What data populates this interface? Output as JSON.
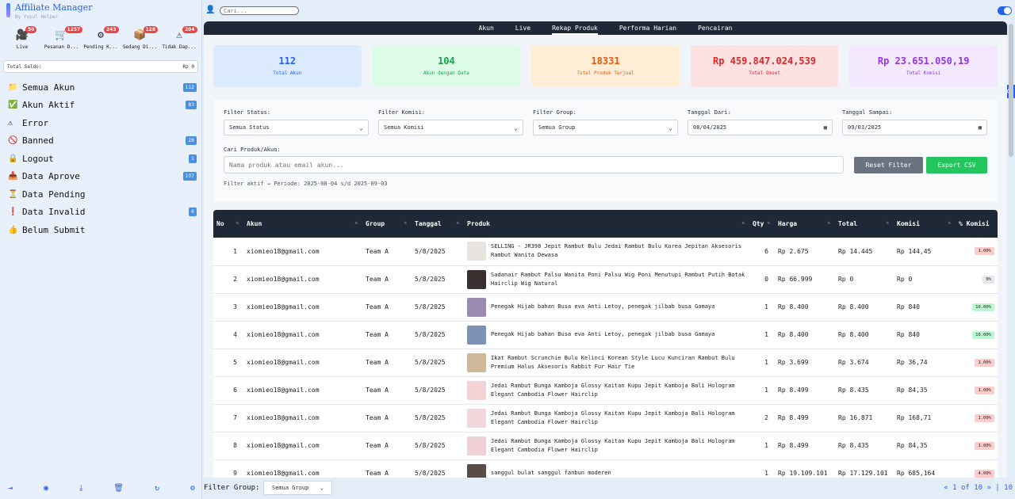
{
  "app": {
    "title": "Affiliate Manager",
    "subtitle": "By Yuyul Helper"
  },
  "stats": [
    {
      "icon": "camera-icon",
      "glyph": "🎥",
      "badge": "50",
      "label": "Live"
    },
    {
      "icon": "cart-icon",
      "glyph": "🛒",
      "badge": "1257",
      "label": "Pesanan D..."
    },
    {
      "icon": "gear-icon",
      "glyph": "⚙",
      "badge": "243",
      "label": "Pending K..."
    },
    {
      "icon": "package-icon",
      "glyph": "📦",
      "badge": "128",
      "label": "Sedang Di..."
    },
    {
      "icon": "warning-icon",
      "glyph": "⚠",
      "badge": "204",
      "label": "Tidak Dap..."
    }
  ],
  "saldo": {
    "label": "Total Saldo:",
    "value": "Rp 0"
  },
  "menu": [
    {
      "icon": "folder-icon",
      "glyph": "📁",
      "label": "Semua Akun",
      "count": "112"
    },
    {
      "icon": "check-icon",
      "glyph": "✅",
      "label": "Akun Aktif",
      "count": "83"
    },
    {
      "icon": "warning-icon",
      "glyph": "⚠",
      "label": "Error",
      "count": ""
    },
    {
      "icon": "ban-icon",
      "glyph": "🚫",
      "label": "Banned",
      "count": "28"
    },
    {
      "icon": "lock-icon",
      "glyph": "🔒",
      "label": "Logout",
      "count": "1"
    },
    {
      "icon": "inbox-icon",
      "glyph": "📥",
      "label": "Data Aprove",
      "count": "107"
    },
    {
      "icon": "hourglass-icon",
      "glyph": "⏳",
      "label": "Data Pending",
      "count": ""
    },
    {
      "icon": "exclamation-icon",
      "glyph": "❗",
      "label": "Data Invalid",
      "count": "6"
    },
    {
      "icon": "thumbs-up-icon",
      "glyph": "👍",
      "label": "Belum Submit",
      "count": ""
    }
  ],
  "search": {
    "placeholder": "Cari..."
  },
  "tabs": [
    "Akun",
    "Live",
    "Rekap Produk",
    "Performa Harian",
    "Pencairan"
  ],
  "active_tab": "Rekap Produk",
  "cards": [
    {
      "value": "112",
      "label": "Total Akun",
      "color": "#2563eb",
      "bg": "#dbeafe"
    },
    {
      "value": "104",
      "label": "Akun dengan Data",
      "color": "#16a34a",
      "bg": "#dcfce7"
    },
    {
      "value": "18331",
      "label": "Total Produk Terjual",
      "color": "#ea580c",
      "bg": "#ffedd5"
    },
    {
      "value": "Rp 459.847.024,539",
      "label": "Total Omset",
      "color": "#dc2626",
      "bg": "#fee2e2"
    },
    {
      "value": "Rp 23.651.050,19",
      "label": "Total Komisi",
      "color": "#9333ea",
      "bg": "#f3e8ff"
    }
  ],
  "filters": {
    "status": {
      "label": "Filter Status:",
      "value": "Semua Status"
    },
    "komisi": {
      "label": "Filter Komisi:",
      "value": "Semua Komisi"
    },
    "group": {
      "label": "Filter Group:",
      "value": "Semua Group"
    },
    "date_from": {
      "label": "Tanggal Dari:",
      "value": "08/04/2025"
    },
    "date_to": {
      "label": "Tanggal Sampai:",
      "value": "09/03/2025"
    },
    "search_label": "Cari Produk/Akun:",
    "search_placeholder": "Nama produk atau email akun...",
    "reset_label": "Reset Filter",
    "export_label": "Export CSV",
    "active_text": "Filter aktif → Periode: 2025-08-04 s/d 2025-09-03"
  },
  "table": {
    "headers": [
      "No",
      "Akun",
      "Group",
      "Tanggal",
      "Produk",
      "Qty",
      "Harga",
      "Total",
      "Komisi",
      "% Komisi"
    ],
    "rows": [
      {
        "no": "1",
        "akun": "xiomieo18@gmail.com",
        "group": "Team A",
        "tanggal": "5/8/2025",
        "produk": "SELLING - JR398 Jepit Rambut Bulu Jedai Rambut Bulu Korea Jepitan Aksesoris Rambut Wanita Dewasa",
        "thumb": "#e8e4e0",
        "qty": "6",
        "harga": "Rp 2.675",
        "total": "Rp 14.445",
        "komisi": "Rp 144,45",
        "pct": "1.00%",
        "pct_color": "#fecaca"
      },
      {
        "no": "2",
        "akun": "xiomieo18@gmail.com",
        "group": "Team A",
        "tanggal": "5/8/2025",
        "produk": "Sadanair Rambut Palsu Wanita Poni Palsu Wig Poni Menutupi Rambut Putih Botak Hairclip Wig Natural",
        "thumb": "#3a3030",
        "qty": "0",
        "harga": "Rp 66.999",
        "total": "Rp 0",
        "komisi": "Rp 0",
        "pct": "0%",
        "pct_color": "#e5e7eb"
      },
      {
        "no": "3",
        "akun": "xiomieo18@gmail.com",
        "group": "Team A",
        "tanggal": "5/8/2025",
        "produk": "Penegak Hijab bahan Busa eva Anti Letoy, penegak jilbab busa Gamaya",
        "thumb": "#9b8bb0",
        "qty": "1",
        "harga": "Rp 8.400",
        "total": "Rp 8.400",
        "komisi": "Rp 840",
        "pct": "10.00%",
        "pct_color": "#bbf7d0"
      },
      {
        "no": "4",
        "akun": "xiomieo18@gmail.com",
        "group": "Team A",
        "tanggal": "5/8/2025",
        "produk": "Penegak Hijab bahan Busa eva Anti Letoy, penegak jilbab busa Gamaya",
        "thumb": "#7e92b8",
        "qty": "1",
        "harga": "Rp 8.400",
        "total": "Rp 8.400",
        "komisi": "Rp 840",
        "pct": "10.00%",
        "pct_color": "#bbf7d0"
      },
      {
        "no": "5",
        "akun": "xiomieo18@gmail.com",
        "group": "Team A",
        "tanggal": "5/8/2025",
        "produk": "Ikat Rambut Scrunchie Bulu Kelinci Korean Style Lucu Kunciran Rambut Bulu Premium Halus Aksesoris Rabbit Fur Hair Tie",
        "thumb": "#cdb89a",
        "qty": "1",
        "harga": "Rp 3.699",
        "total": "Rp 3.674",
        "komisi": "Rp 36,74",
        "pct": "1.00%",
        "pct_color": "#fecaca"
      },
      {
        "no": "6",
        "akun": "xiomieo18@gmail.com",
        "group": "Team A",
        "tanggal": "5/8/2025",
        "produk": "Jedai Rambut Bunga Kamboja Glossy Kaitan Kupu Jepit Kamboja Bali Hologram Elegant Cambodia Flower Hairclip",
        "thumb": "#f2d4d4",
        "qty": "1",
        "harga": "Rp 8.499",
        "total": "Rp 8.435",
        "komisi": "Rp 84,35",
        "pct": "1.00%",
        "pct_color": "#fecaca"
      },
      {
        "no": "7",
        "akun": "xiomieo18@gmail.com",
        "group": "Team A",
        "tanggal": "5/8/2025",
        "produk": "Jedai Rambut Bunga Kamboja Glossy Kaitan Kupu Jepit Kamboja Bali Hologram Elegant Cambodia Flower Hairclip",
        "thumb": "#f0d8dc",
        "qty": "2",
        "harga": "Rp 8.499",
        "total": "Rp 16.871",
        "komisi": "Rp 168,71",
        "pct": "1.00%",
        "pct_color": "#fecaca"
      },
      {
        "no": "8",
        "akun": "xiomieo18@gmail.com",
        "group": "Team A",
        "tanggal": "5/8/2025",
        "produk": "Jedai Rambut Bunga Kamboja Glossy Kaitan Kupu Jepit Kamboja Bali Hologram Elegant Cambodia Flower Hairclip",
        "thumb": "#eed0d6",
        "qty": "1",
        "harga": "Rp 8.499",
        "total": "Rp 8.435",
        "komisi": "Rp 84,35",
        "pct": "1.00%",
        "pct_color": "#fecaca"
      },
      {
        "no": "9",
        "akun": "xiomieo18@gmail.com",
        "group": "Team A",
        "tanggal": "5/8/2025",
        "produk": "sanggul bulat sanggul fanbun moderen",
        "thumb": "#5a4a48",
        "qty": "1",
        "harga": "Rp 19.109.101",
        "total": "Rp 17.129.101",
        "komisi": "Rp 685,164",
        "pct": "4.00%",
        "pct_color": "#fecaca"
      }
    ]
  },
  "footer": {
    "group_label": "Filter Group:",
    "group_value": "Semua Group",
    "pagination": "« 1 of 10 »",
    "page_size": "10"
  }
}
